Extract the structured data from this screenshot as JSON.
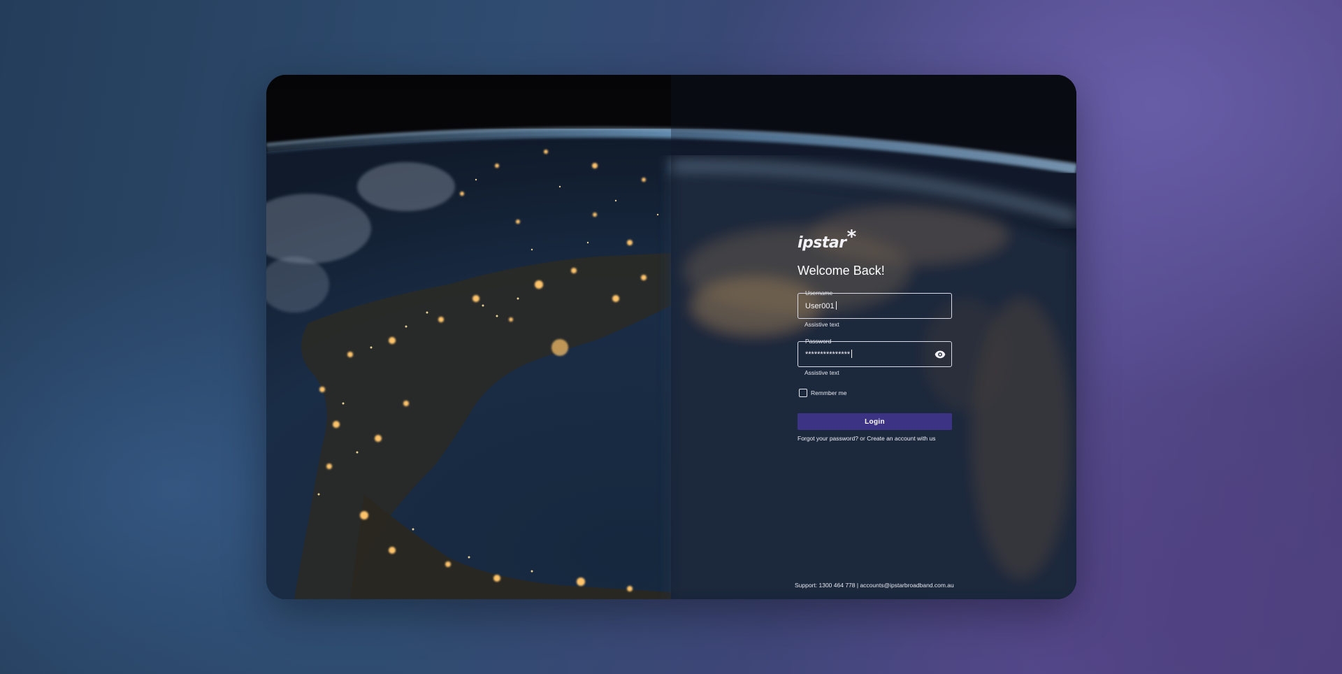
{
  "brand": {
    "name": "ipstar",
    "mark": "*"
  },
  "login": {
    "heading": "Welcome Back!",
    "username": {
      "label": "Username",
      "value": "User001",
      "assistive": "Assistive text"
    },
    "password": {
      "label": "Password",
      "value": "***************",
      "assistive": "Assistive text"
    },
    "remember_label": "Remmber me",
    "login_button": "Login",
    "forgot_link": "Forgot your password?",
    "or_text": " or ",
    "create_link": "Create an account with us"
  },
  "footer": {
    "support_prefix": "Support: ",
    "phone": "1300 464 778",
    "separator": " | ",
    "email": "accounts@ipstarbroadband.com.au"
  },
  "colors": {
    "accent": "#3d3384",
    "text": "#ffffff"
  },
  "icons": {
    "password_toggle": "eye-icon"
  }
}
